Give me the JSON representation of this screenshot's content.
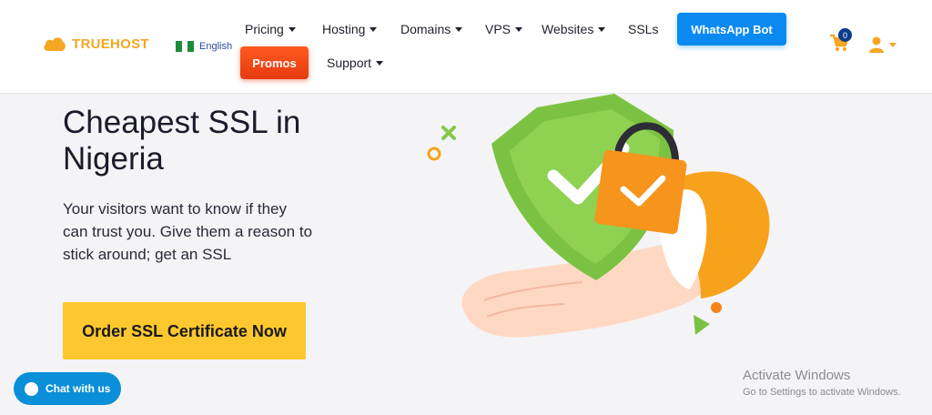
{
  "brand": {
    "name": "TRUEHOST",
    "color": "#f5a623"
  },
  "language": {
    "label": "English",
    "flag": "nigeria-flag"
  },
  "nav": {
    "pricing": "Pricing",
    "hosting": "Hosting",
    "domains": "Domains",
    "vps": "VPS",
    "websites": "Websites",
    "ssls": "SSLs",
    "support": "Support"
  },
  "buttons": {
    "whatsapp": "WhatsApp Bot",
    "promos": "Promos",
    "order": "Order SSL Certificate Now"
  },
  "cart": {
    "count": "0"
  },
  "hero": {
    "title": "Cheapest SSL  in Nigeria",
    "subtitle": "Your visitors want to know if they can trust you. Give them a reason to stick around; get an SSL"
  },
  "chat": {
    "label": "Chat with us"
  },
  "watermark": {
    "line1": "Activate Windows",
    "line2": "Go to Settings to activate Windows."
  },
  "colors": {
    "accent_blue": "#0a8af0",
    "promo_orange": "#ff5a1f",
    "cta_yellow": "#fdc82f",
    "shield_green": "#7cc242"
  }
}
